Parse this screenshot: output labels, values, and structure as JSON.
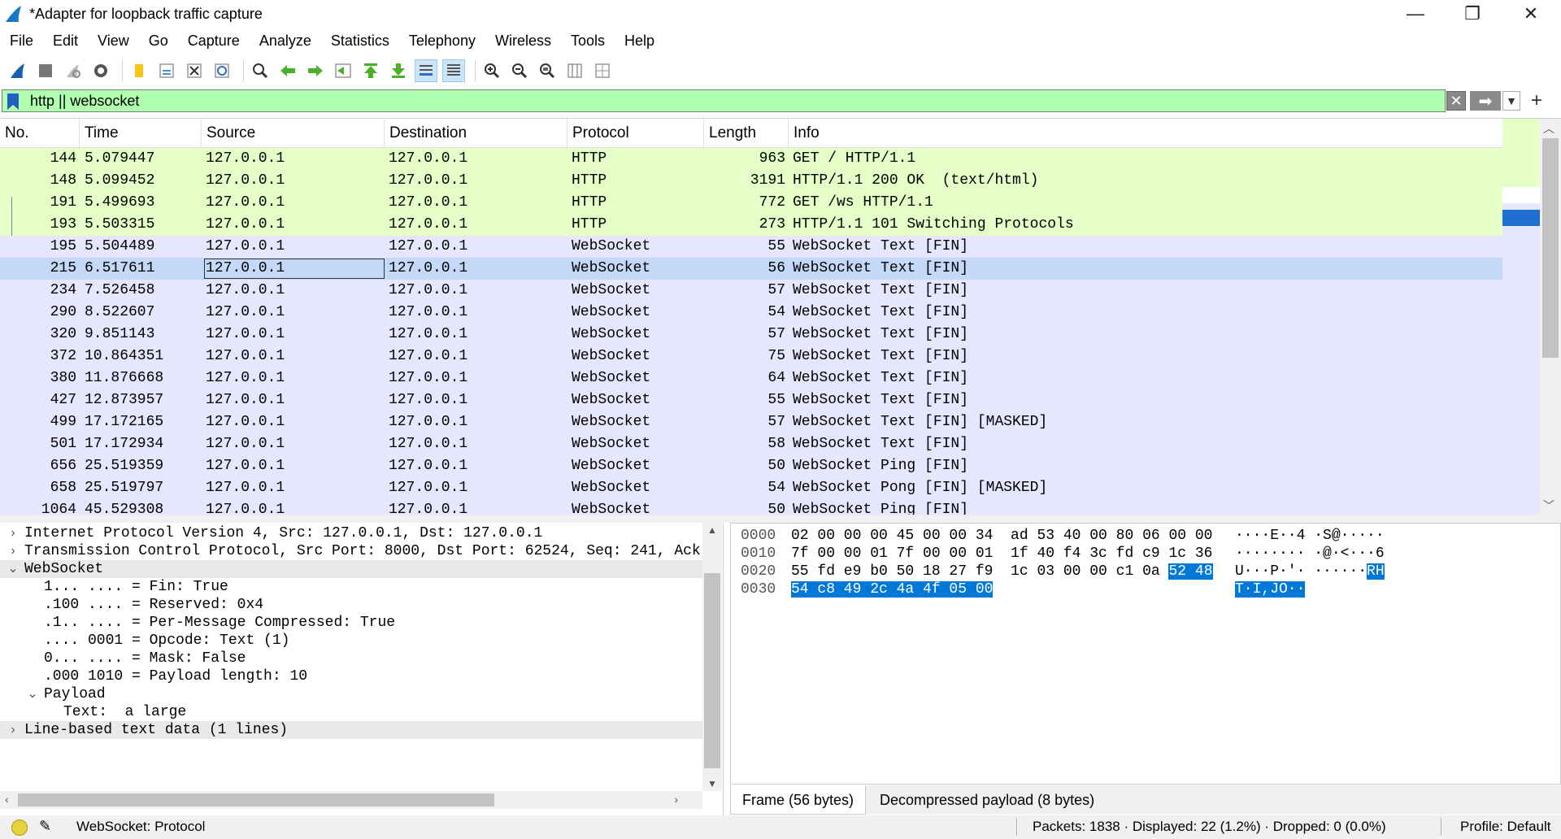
{
  "window": {
    "title": "*Adapter for loopback traffic capture",
    "minimize": "—",
    "restore": "❐",
    "close": "✕"
  },
  "menu": [
    "File",
    "Edit",
    "View",
    "Go",
    "Capture",
    "Analyze",
    "Statistics",
    "Telephony",
    "Wireless",
    "Tools",
    "Help"
  ],
  "filter": {
    "value": "http || websocket",
    "bg_color": "#afffaf"
  },
  "packet_list": {
    "columns": [
      "No.",
      "Time",
      "Source",
      "Destination",
      "Protocol",
      "Length",
      "Info"
    ],
    "rows": [
      {
        "no": "144",
        "time": "5.079447",
        "src": "127.0.0.1",
        "dst": "127.0.0.1",
        "proto": "HTTP",
        "len": "963",
        "info": "GET / HTTP/1.1"
      },
      {
        "no": "148",
        "time": "5.099452",
        "src": "127.0.0.1",
        "dst": "127.0.0.1",
        "proto": "HTTP",
        "len": "3191",
        "info": "HTTP/1.1 200 OK  (text/html)"
      },
      {
        "no": "191",
        "time": "5.499693",
        "src": "127.0.0.1",
        "dst": "127.0.0.1",
        "proto": "HTTP",
        "len": "772",
        "info": "GET /ws HTTP/1.1"
      },
      {
        "no": "193",
        "time": "5.503315",
        "src": "127.0.0.1",
        "dst": "127.0.0.1",
        "proto": "HTTP",
        "len": "273",
        "info": "HTTP/1.1 101 Switching Protocols"
      },
      {
        "no": "195",
        "time": "5.504489",
        "src": "127.0.0.1",
        "dst": "127.0.0.1",
        "proto": "WebSocket",
        "len": "55",
        "info": "WebSocket Text [FIN]"
      },
      {
        "no": "215",
        "time": "6.517611",
        "src": "127.0.0.1",
        "dst": "127.0.0.1",
        "proto": "WebSocket",
        "len": "56",
        "info": "WebSocket Text [FIN]"
      },
      {
        "no": "234",
        "time": "7.526458",
        "src": "127.0.0.1",
        "dst": "127.0.0.1",
        "proto": "WebSocket",
        "len": "57",
        "info": "WebSocket Text [FIN]"
      },
      {
        "no": "290",
        "time": "8.522607",
        "src": "127.0.0.1",
        "dst": "127.0.0.1",
        "proto": "WebSocket",
        "len": "54",
        "info": "WebSocket Text [FIN]"
      },
      {
        "no": "320",
        "time": "9.851143",
        "src": "127.0.0.1",
        "dst": "127.0.0.1",
        "proto": "WebSocket",
        "len": "57",
        "info": "WebSocket Text [FIN]"
      },
      {
        "no": "372",
        "time": "10.864351",
        "src": "127.0.0.1",
        "dst": "127.0.0.1",
        "proto": "WebSocket",
        "len": "75",
        "info": "WebSocket Text [FIN]"
      },
      {
        "no": "380",
        "time": "11.876668",
        "src": "127.0.0.1",
        "dst": "127.0.0.1",
        "proto": "WebSocket",
        "len": "64",
        "info": "WebSocket Text [FIN]"
      },
      {
        "no": "427",
        "time": "12.873957",
        "src": "127.0.0.1",
        "dst": "127.0.0.1",
        "proto": "WebSocket",
        "len": "55",
        "info": "WebSocket Text [FIN]"
      },
      {
        "no": "499",
        "time": "17.172165",
        "src": "127.0.0.1",
        "dst": "127.0.0.1",
        "proto": "WebSocket",
        "len": "57",
        "info": "WebSocket Text [FIN] [MASKED]"
      },
      {
        "no": "501",
        "time": "17.172934",
        "src": "127.0.0.1",
        "dst": "127.0.0.1",
        "proto": "WebSocket",
        "len": "58",
        "info": "WebSocket Text [FIN]"
      },
      {
        "no": "656",
        "time": "25.519359",
        "src": "127.0.0.1",
        "dst": "127.0.0.1",
        "proto": "WebSocket",
        "len": "50",
        "info": "WebSocket Ping [FIN]"
      },
      {
        "no": "658",
        "time": "25.519797",
        "src": "127.0.0.1",
        "dst": "127.0.0.1",
        "proto": "WebSocket",
        "len": "54",
        "info": "WebSocket Pong [FIN] [MASKED]"
      },
      {
        "no": "1064",
        "time": "45.529308",
        "src": "127.0.0.1",
        "dst": "127.0.0.1",
        "proto": "WebSocket",
        "len": "50",
        "info": "WebSocket Ping [FIN]"
      }
    ],
    "selected_no": "215",
    "colors": {
      "http": "#e4ffc7",
      "websocket": "#e7e6ff",
      "selected": "#c3d9f7"
    }
  },
  "details": {
    "rows": [
      {
        "chev": "›",
        "text": "Internet Protocol Version 4, Src: 127.0.0.1, Dst: 127.0.0.1"
      },
      {
        "chev": "›",
        "text": "Transmission Control Protocol, Src Port: 8000, Dst Port: 62524, Seq: 241, Ack"
      },
      {
        "chev": "⌄",
        "text": "WebSocket"
      },
      {
        "chev": "",
        "text": "1... .... = Fin: True"
      },
      {
        "chev": "",
        "text": ".100 .... = Reserved: 0x4"
      },
      {
        "chev": "",
        "text": ".1.. .... = Per-Message Compressed: True"
      },
      {
        "chev": "",
        "text": ".... 0001 = Opcode: Text (1)"
      },
      {
        "chev": "",
        "text": "0... .... = Mask: False"
      },
      {
        "chev": "",
        "text": ".000 1010 = Payload length: 10"
      },
      {
        "chev": "⌄",
        "text": "Payload"
      },
      {
        "chev": "",
        "text": "Text:  a large"
      },
      {
        "chev": "›",
        "text": "Line-based text data (1 lines)"
      }
    ]
  },
  "bytes": {
    "rows": [
      {
        "offset": "0000",
        "hex": "02 00 00 00 45 00 00 34  ad 53 40 00 80 06 00 00",
        "hex_hl": "",
        "ascii": "····E··4 ·S@·····",
        "ascii_hl": ""
      },
      {
        "offset": "0010",
        "hex": "7f 00 00 01 7f 00 00 01  1f 40 f4 3c fd c9 1c 36",
        "hex_hl": "",
        "ascii": "········ ·@·<···6",
        "ascii_hl": ""
      },
      {
        "offset": "0020",
        "hex": "55 fd e9 b0 50 18 27 f9  1c 03 00 00 c1 0a ",
        "hex_hl": "52 48",
        "ascii": "U···P·'· ······",
        "ascii_hl": "RH"
      },
      {
        "offset": "0030",
        "hex": "",
        "hex_hl": "54 c8 49 2c 4a 4f 05 00",
        "ascii": "",
        "ascii_hl": "T·I,JO··"
      }
    ],
    "tabs": [
      "Frame (56 bytes)",
      "Decompressed payload (8 bytes)"
    ]
  },
  "status": {
    "field": "WebSocket: Protocol",
    "packets": "Packets: 1838 · Displayed: 22 (1.2%) · Dropped: 0 (0.0%)",
    "profile": "Profile: Default"
  },
  "icons": [
    "shark-fin-icon",
    "stop-icon",
    "restart-icon",
    "options-gear-icon",
    "open-folder-icon",
    "save-icon",
    "close-file-icon",
    "reload-icon",
    "find-icon",
    "back-arrow-icon",
    "forward-arrow-icon",
    "go-to-packet-icon",
    "first-packet-icon",
    "last-packet-icon",
    "autoscroll-icon",
    "colorize-icon",
    "zoom-in-icon",
    "zoom-out-icon",
    "normal-size-icon",
    "resize-columns-icon"
  ]
}
